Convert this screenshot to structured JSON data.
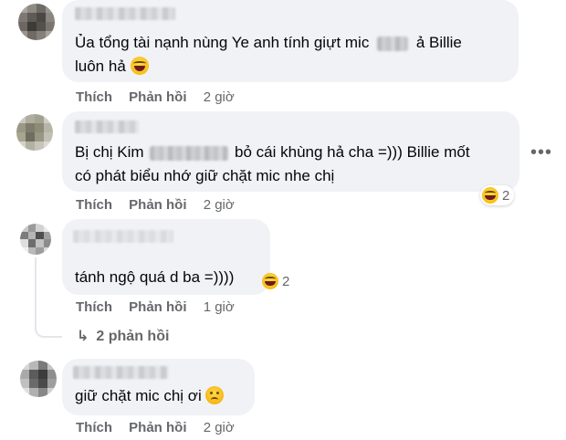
{
  "comments": [
    {
      "line1_prefix": "Ủa tổng tài nạnh nùng Ye anh tính giựt mic",
      "line1_suffix": "ả Billie",
      "line2": "luôn hả",
      "actions": {
        "like": "Thích",
        "reply": "Phản hồi",
        "time": "2 giờ"
      }
    },
    {
      "line1_prefix": "Bị chị Kim",
      "line1_suffix": "bỏ cái khùng hả cha =))) Billie mốt",
      "line2": "có phát biểu nhớ giữ chặt mic nhe chị",
      "reaction_count": "2",
      "actions": {
        "like": "Thích",
        "reply": "Phản hồi",
        "time": "2 giờ"
      }
    },
    {
      "line1": "tánh ngộ quá d ba =))))",
      "reaction_count": "2",
      "actions": {
        "like": "Thích",
        "reply": "Phản hồi",
        "time": "1 giờ"
      },
      "replies_label": "2 phản hồi"
    },
    {
      "line1": "giữ chặt mic chị ơi",
      "actions": {
        "like": "Thích",
        "reply": "Phản hồi",
        "time": "2 giờ"
      }
    }
  ],
  "icons": {
    "more": "more-horizontal-icon",
    "reply_arrow": "reply-arrow-icon",
    "laugh": "laughing-emoji-icon",
    "sad": "sad-emoji-icon"
  },
  "colors": {
    "bubble_bg": "#f0f2f5",
    "secondary_text": "#65676b",
    "primary_text": "#050505"
  }
}
